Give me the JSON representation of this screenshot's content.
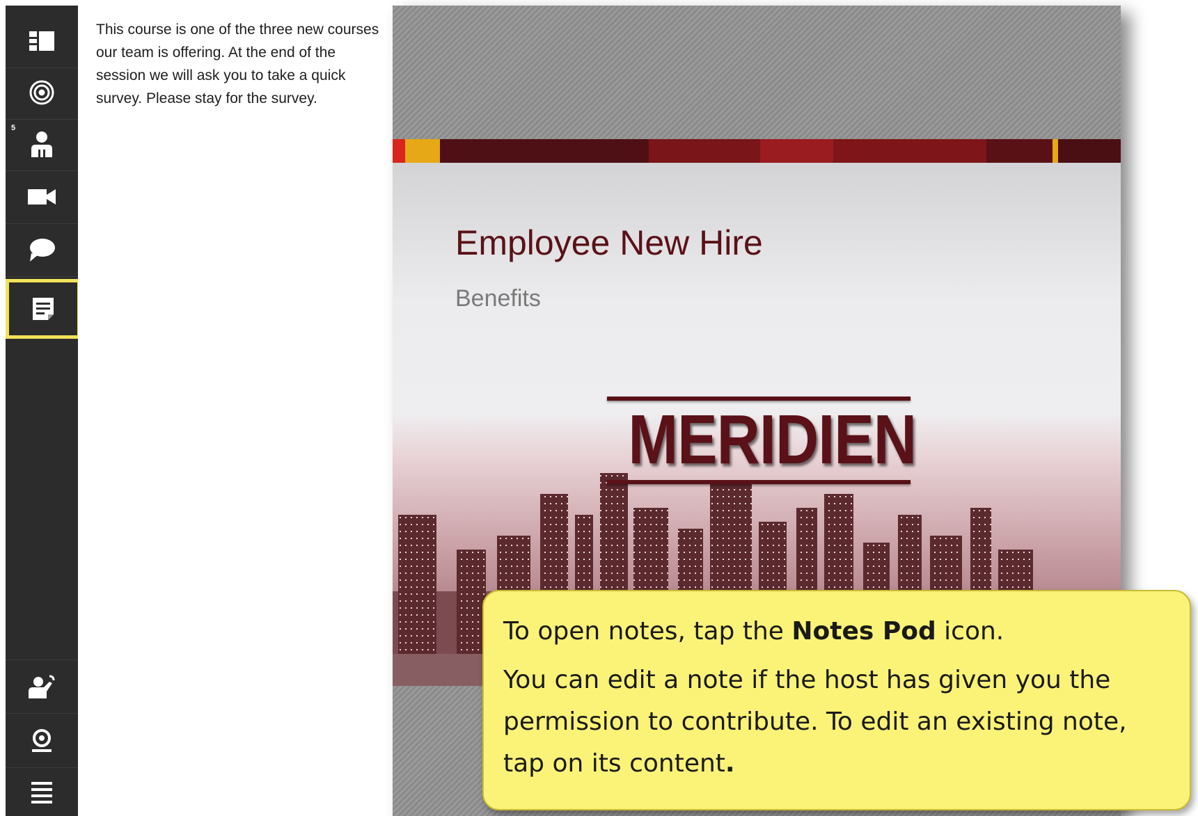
{
  "sidebar": {
    "participants_badge": "5",
    "items": [
      {
        "name": "layout-icon"
      },
      {
        "name": "target-icon"
      },
      {
        "name": "attendees-icon"
      },
      {
        "name": "video-camera-icon"
      },
      {
        "name": "chat-bubble-icon"
      },
      {
        "name": "notes-pod-icon"
      },
      {
        "name": "raise-hand-icon"
      },
      {
        "name": "webcam-icon"
      },
      {
        "name": "menu-icon"
      }
    ]
  },
  "notes": {
    "text": "This course is one of the three new courses our team is offering. At the end of the session we will ask you to take a quick survey. Please stay for the survey."
  },
  "slide": {
    "title": "Employee New Hire",
    "subtitle": "Benefits",
    "logo": "MERIDIEN",
    "colors": {
      "title": "#5a1117",
      "accent": "#8b1a1f",
      "highlight": "#e6a817"
    }
  },
  "callout": {
    "line1_prefix": "To open notes, tap the ",
    "line1_bold": "Notes Pod",
    "line1_suffix": " icon.",
    "line2": "You can edit a note if the host has given you the permission to contribute. To edit an existing note, tap on its content",
    "line2_end": "."
  },
  "theme": {
    "callout_bg": "#fbf377",
    "sidebar_bg": "#2c2c2c",
    "active_outline": "#f1e25a"
  }
}
